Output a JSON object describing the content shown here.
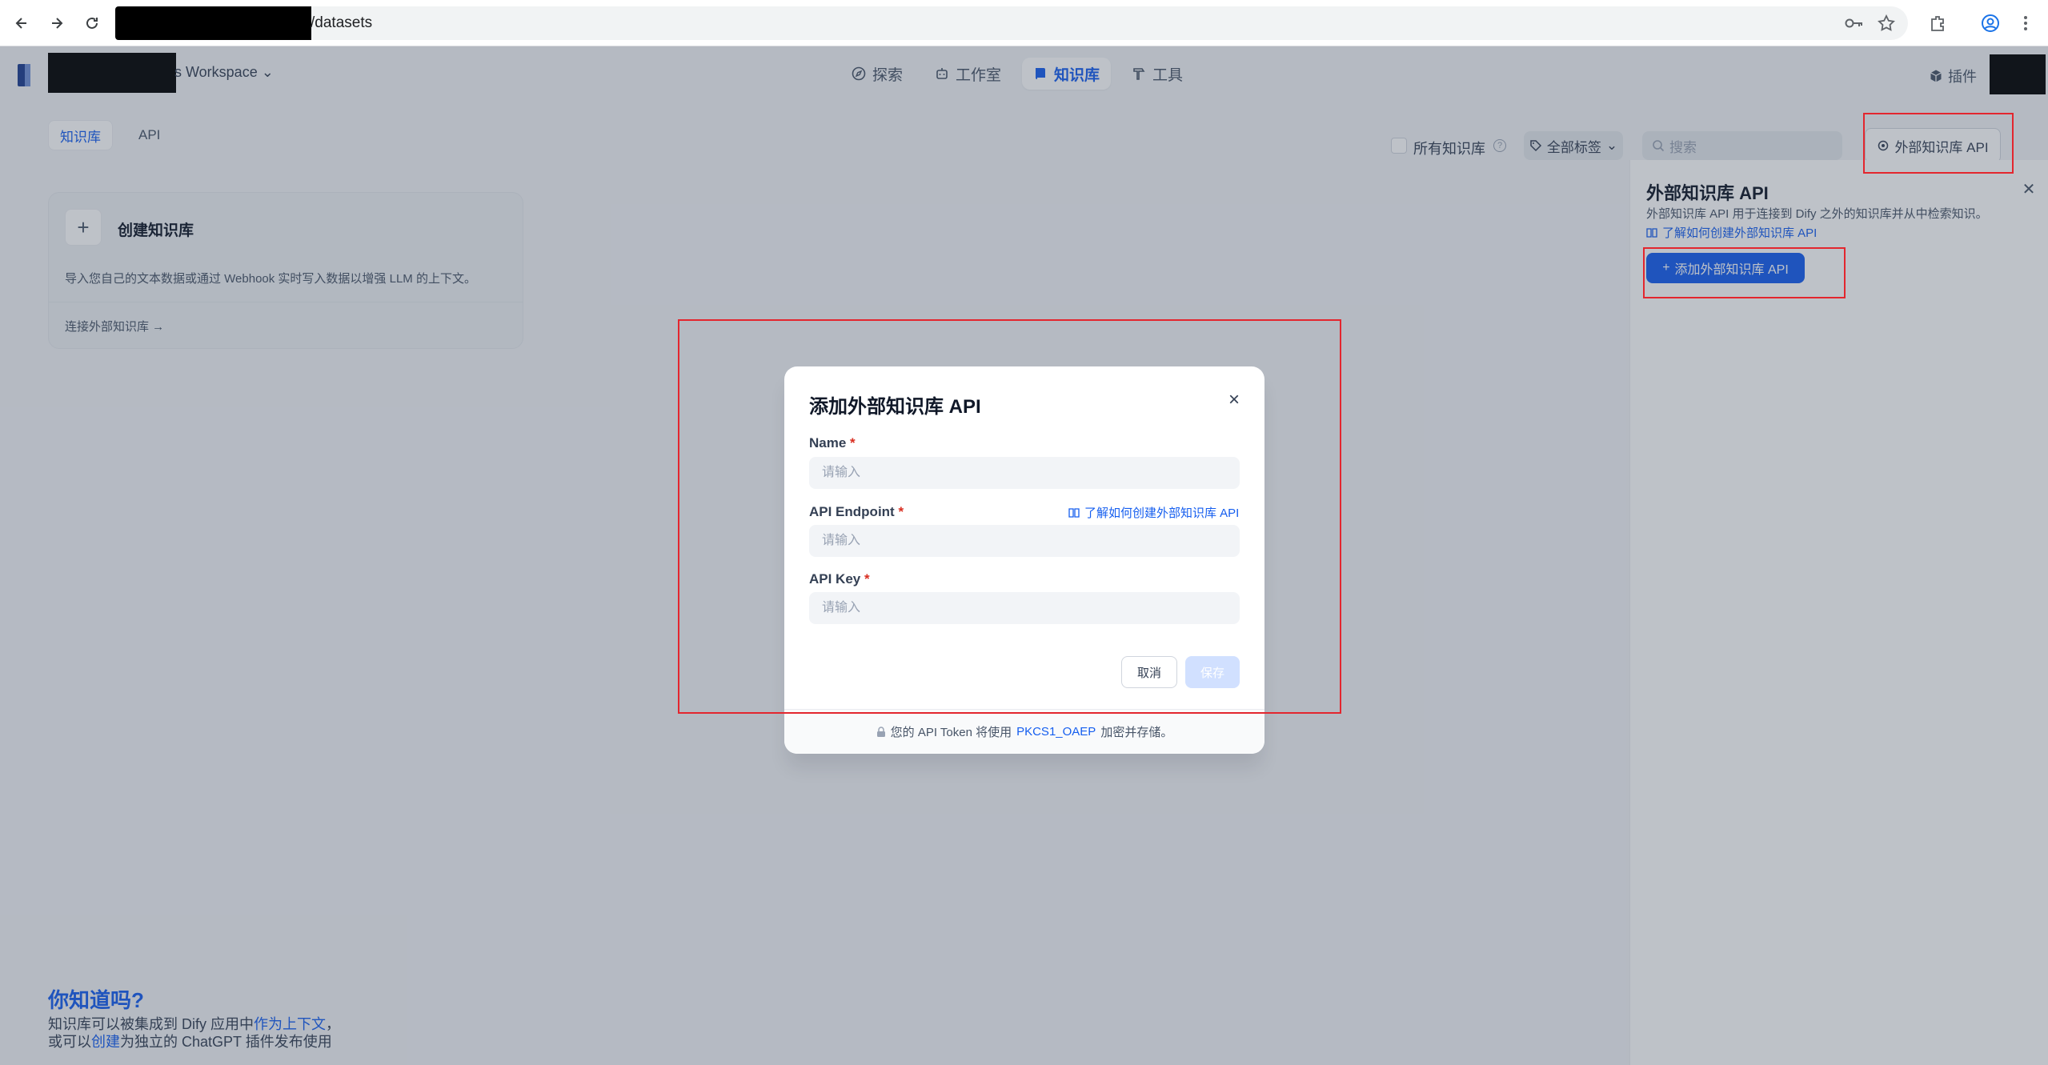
{
  "browser": {
    "url_path": "/datasets",
    "icons": [
      "back-icon",
      "forward-icon",
      "reload-icon",
      "password-key-icon",
      "bookmark-star-icon",
      "extensions-icon",
      "profile-icon",
      "menu-dots-icon"
    ]
  },
  "header": {
    "workspace_name": "s Workspace",
    "tabs": [
      {
        "label": "探索",
        "icon": "compass-icon",
        "active": false
      },
      {
        "label": "工作室",
        "icon": "robot-icon",
        "active": false
      },
      {
        "label": "知识库",
        "icon": "book-icon",
        "active": true
      },
      {
        "label": "工具",
        "icon": "hammer-icon",
        "active": false
      }
    ],
    "plugins_label": "插件"
  },
  "subtabs": [
    {
      "label": "知识库",
      "active": true
    },
    {
      "label": "API",
      "active": false
    }
  ],
  "filters": {
    "all_kb_label": "所有知识库",
    "tag_filter_label": "全部标签",
    "search_placeholder": "搜索",
    "external_api_button": "外部知识库 API"
  },
  "create_card": {
    "title": "创建知识库",
    "description": "导入您自己的文本数据或通过 Webhook 实时写入数据以增强 LLM 的上下文。",
    "connect_link": "连接外部知识库 →"
  },
  "tip": {
    "title": "你知道吗?",
    "line1_prefix": "知识库可以被集成到 Dify 应用中",
    "line1_link": "作为上下文",
    "line1_suffix": "，",
    "line2_prefix": "或可以",
    "line2_link": "创建",
    "line2_suffix": "为独立的 ChatGPT 插件发布使用"
  },
  "side_panel": {
    "title": "外部知识库 API",
    "description": "外部知识库 API 用于连接到 Dify 之外的知识库并从中检索知识。",
    "learn_link": "了解如何创建外部知识库 API",
    "add_button": "添加外部知识库 API"
  },
  "modal": {
    "title": "添加外部知识库 API",
    "fields": [
      {
        "label": "Name",
        "placeholder": "请输入",
        "value": ""
      },
      {
        "label": "API Endpoint",
        "placeholder": "请输入",
        "value": ""
      },
      {
        "label": "API Key",
        "placeholder": "请输入",
        "value": ""
      }
    ],
    "required_mark": "*",
    "help_link": "了解如何创建外部知识库 API",
    "cancel_label": "取消",
    "save_label": "保存",
    "footer_prefix": "您的 API Token 将使用",
    "footer_link": "PKCS1_OAEP",
    "footer_suffix": "加密并存储。"
  },
  "colors": {
    "accent": "#155eef",
    "highlight": "#e3262e"
  }
}
